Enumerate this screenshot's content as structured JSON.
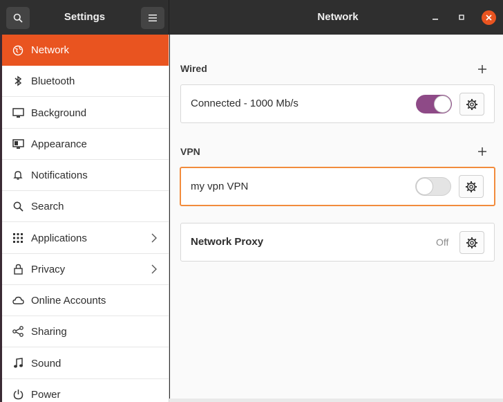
{
  "headerbar": {
    "sidebar_title": "Settings",
    "main_title": "Network",
    "search_icon": "search-icon",
    "menu_icon": "hamburger-menu-icon",
    "close_color": "#e95420"
  },
  "sidebar": {
    "items": [
      {
        "label": "Network",
        "icon": "network-globe-icon"
      },
      {
        "label": "Bluetooth",
        "icon": "bluetooth-icon"
      },
      {
        "label": "Background",
        "icon": "background-monitor-icon"
      },
      {
        "label": "Appearance",
        "icon": "appearance-icon"
      },
      {
        "label": "Notifications",
        "icon": "bell-icon"
      },
      {
        "label": "Search",
        "icon": "search-icon"
      },
      {
        "label": "Applications",
        "icon": "grid-icon"
      },
      {
        "label": "Privacy",
        "icon": "lock-icon"
      },
      {
        "label": "Online Accounts",
        "icon": "cloud-icon"
      },
      {
        "label": "Sharing",
        "icon": "share-icon"
      },
      {
        "label": "Sound",
        "icon": "music-note-icon"
      },
      {
        "label": "Power",
        "icon": "power-icon"
      }
    ],
    "active_color": "#e95420"
  },
  "main": {
    "wired": {
      "title": "Wired",
      "connection_label": "Connected - 1000 Mb/s",
      "toggle_on": true
    },
    "vpn": {
      "title": "VPN",
      "connection_label": "my vpn VPN",
      "toggle_on": false
    },
    "proxy": {
      "label": "Network Proxy",
      "status": "Off"
    },
    "toggle_color": "#8e4a87",
    "highlight_color": "#f28b3c"
  }
}
